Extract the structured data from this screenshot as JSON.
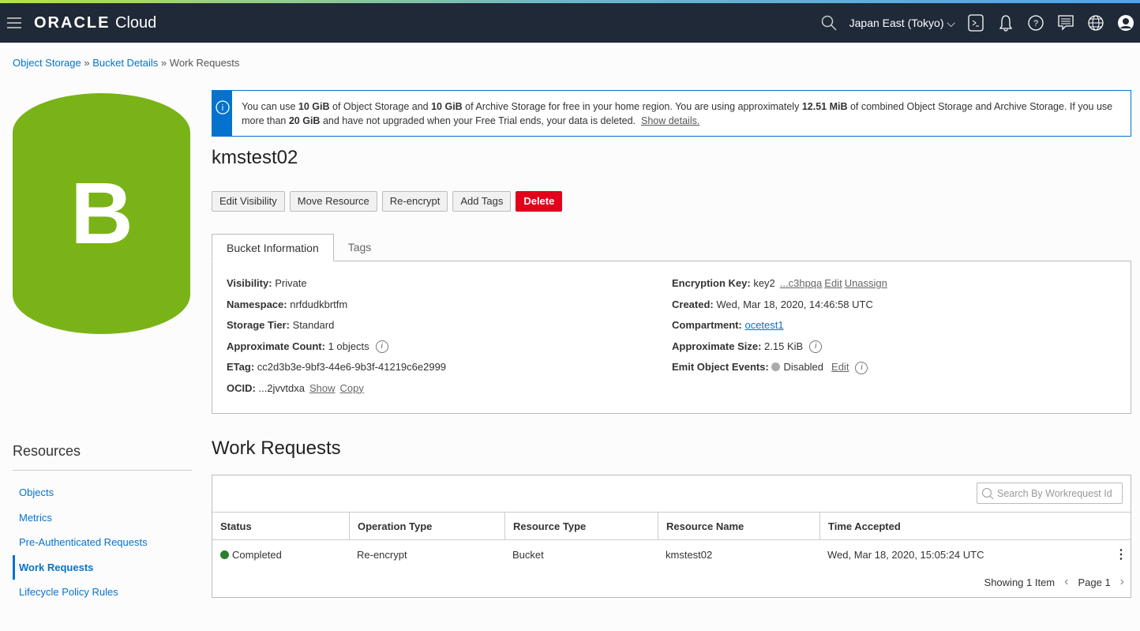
{
  "colors": {
    "accent": "#0572ce",
    "bucket": "#7ab317",
    "delete": "#e2001a",
    "completed": "#2e7d32",
    "disabled": "#aaaaaa"
  },
  "nav": {
    "logo_brand": "ORACLE",
    "logo_product": "Cloud",
    "region": "Japan East (Tokyo)",
    "icons": [
      "menu-icon",
      "search-icon",
      "cloud-shell-icon",
      "bell-icon",
      "help-icon",
      "chat-icon",
      "globe-icon",
      "user-icon"
    ]
  },
  "breadcrumb": {
    "items": [
      "Object Storage",
      "Bucket Details"
    ],
    "sep": "»",
    "current": "Work Requests"
  },
  "bucket_letter": "B",
  "info": {
    "t1": "You can use ",
    "v1": "10 GiB",
    "t2": " of Object Storage and ",
    "v2": "10 GiB",
    "t3": " of Archive Storage for free in your home region. You are using approximately ",
    "v3": "12.51 MiB",
    "t4": " of combined Object Storage and Archive Storage. If you use more than ",
    "v4": "20 GiB",
    "t5": " and have not upgraded when your Free Trial ends, your data is deleted.",
    "link": "Show details."
  },
  "title": "kmstest02",
  "buttons": [
    "Edit Visibility",
    "Move Resource",
    "Re-encrypt",
    "Add Tags",
    "Delete"
  ],
  "tabs": [
    "Bucket Information",
    "Tags"
  ],
  "details": {
    "visibility": {
      "label": "Visibility:",
      "value": "Private"
    },
    "namespace": {
      "label": "Namespace:",
      "value": "nrfdudkbrtfm"
    },
    "tier": {
      "label": "Storage Tier:",
      "value": "Standard"
    },
    "count": {
      "label": "Approximate Count:",
      "value": "1 objects"
    },
    "etag": {
      "label": "ETag:",
      "value": "cc2d3b3e-9bf3-44e6-9b3f-41219c6e2999"
    },
    "ocid": {
      "label": "OCID:",
      "value": "...2jvvtdxa",
      "show": "Show",
      "copy": "Copy"
    },
    "key": {
      "label": "Encryption Key:",
      "value": "key2",
      "link": "...c3hpqa",
      "edit": "Edit",
      "unassign": "Unassign"
    },
    "created": {
      "label": "Created:",
      "value": "Wed, Mar 18, 2020, 14:46:58 UTC"
    },
    "compartment": {
      "label": "Compartment:",
      "value": "ocetest1"
    },
    "size": {
      "label": "Approximate Size:",
      "value": "2.15 KiB"
    },
    "events": {
      "label": "Emit Object Events:",
      "value": "Disabled",
      "edit": "Edit"
    }
  },
  "resources": {
    "title": "Resources",
    "items": [
      "Objects",
      "Metrics",
      "Pre-Authenticated Requests",
      "Work Requests",
      "Lifecycle Policy Rules"
    ]
  },
  "work_requests": {
    "title": "Work Requests",
    "search_placeholder": "Search By Workrequest Id",
    "columns": [
      "Status",
      "Operation Type",
      "Resource Type",
      "Resource Name",
      "Time Accepted"
    ],
    "rows": [
      [
        "Completed",
        "Re-encrypt",
        "Bucket",
        "kmstest02",
        "Wed, Mar 18, 2020, 15:05:24 UTC"
      ]
    ],
    "showing": "Showing 1 Item",
    "page": "Page 1"
  }
}
